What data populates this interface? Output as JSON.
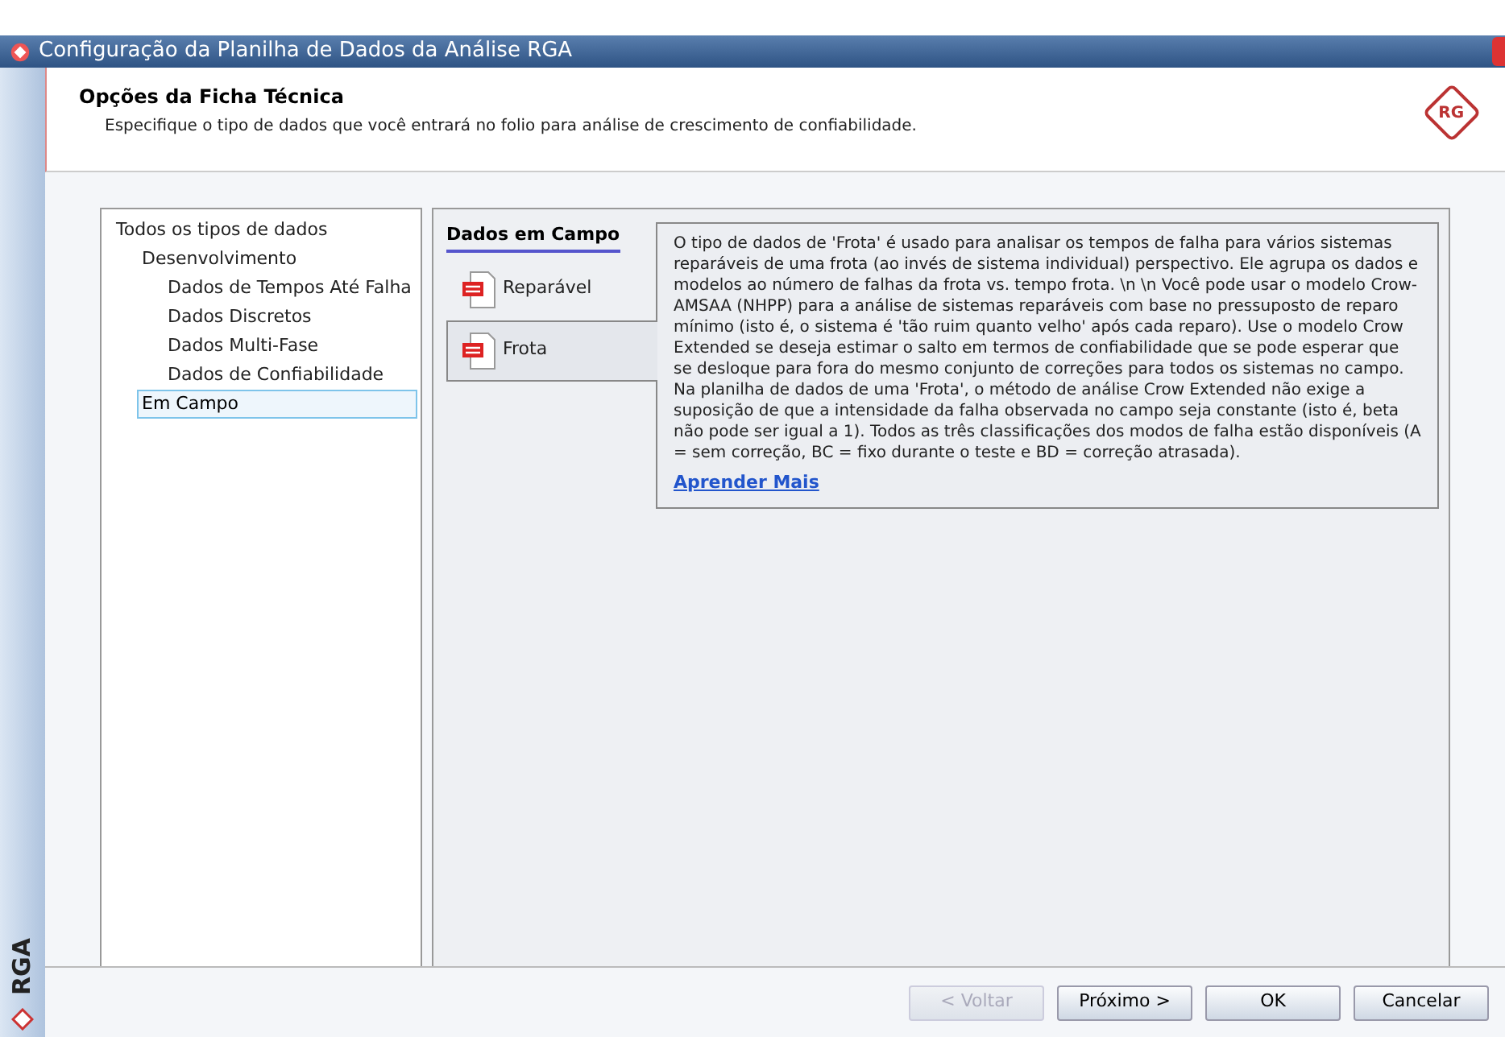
{
  "window": {
    "title": "Configuração da Planilha de Dados da Análise RGA"
  },
  "header": {
    "title": "Opções da Ficha Técnica",
    "subtitle": "Especifique o tipo de dados que você entrará no folio para análise de crescimento de confiabilidade.",
    "logo": "RG"
  },
  "side_brand": "RGA",
  "tree": [
    {
      "label": "Todos os tipos de dados",
      "selected": false,
      "children": [
        {
          "label": "Desenvolvimento",
          "selected": false,
          "children": [
            {
              "label": "Dados de Tempos Até Falha",
              "selected": false
            },
            {
              "label": "Dados Discretos",
              "selected": false
            },
            {
              "label": "Dados Multi-Fase",
              "selected": false
            },
            {
              "label": "Dados de Confiabilidade",
              "selected": false
            }
          ]
        },
        {
          "label": "Em Campo",
          "selected": true
        }
      ]
    }
  ],
  "panel": {
    "heading": "Dados em Campo",
    "tabs": [
      {
        "label": "Reparável",
        "selected": false
      },
      {
        "label": "Frota",
        "selected": true
      }
    ],
    "description": "O tipo de dados de 'Frota' é usado para analisar os tempos de falha para vários sistemas reparáveis de uma frota (ao invés de sistema individual) perspectivo. Ele agrupa os dados e modelos ao número de falhas da frota vs. tempo frota. \\n \\n Você pode usar o modelo Crow-AMSAA (NHPP) para a análise de sistemas reparáveis com base no pressuposto de reparo mínimo (isto é, o sistema é 'tão ruim quanto velho' após cada reparo). Use o modelo Crow Extended se deseja estimar o salto em termos de confiabilidade que se pode esperar que se desloque para fora do mesmo conjunto de correções para todos os sistemas no campo. Na planilha de dados de uma 'Frota', o método de análise Crow Extended não exige a suposição de que a intensidade da falha observada no campo seja constante (isto é, beta não pode ser igual a 1). Todos as três classificações dos modos de falha estão disponíveis (A = sem correção, BC = fixo durante o teste e BD = correção atrasada).",
    "link": "Aprender Mais"
  },
  "buttons": [
    {
      "label": "< Voltar",
      "disabled": true
    },
    {
      "label": "Próximo >",
      "disabled": false
    },
    {
      "label": "OK",
      "disabled": false
    },
    {
      "label": "Cancelar",
      "disabled": false
    }
  ]
}
